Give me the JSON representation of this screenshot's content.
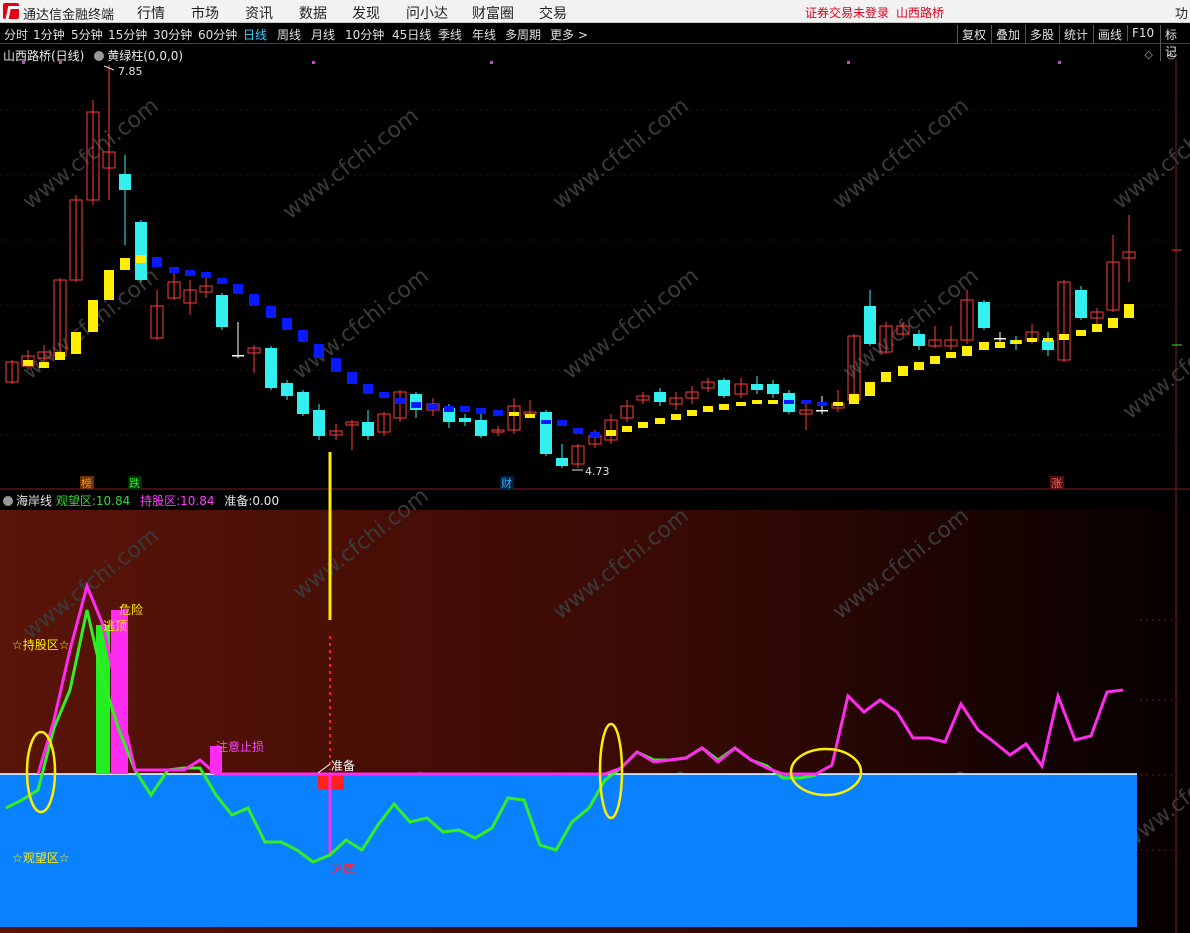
{
  "app": {
    "title": "通达信金融终端",
    "menus": [
      "行情",
      "市场",
      "资讯",
      "数据",
      "发现",
      "问小达",
      "财富圈",
      "交易"
    ],
    "login_notice": "证券交易未登录",
    "account_name": "山西路桥",
    "func_label": "功"
  },
  "periods": {
    "items": [
      "分时",
      "1分钟",
      "5分钟",
      "15分钟",
      "30分钟",
      "60分钟",
      "日线",
      "周线",
      "月线",
      "10分钟",
      "45日线",
      "季线",
      "年线",
      "多周期",
      "更多 >"
    ],
    "active": "日线",
    "right_tools": [
      "复权",
      "叠加",
      "多股",
      "统计",
      "画线",
      "F10",
      "标记"
    ]
  },
  "main_chart": {
    "stock_label": "山西路桥(日线)",
    "indicator_label": "黄绿柱(0,0,0)",
    "high_label": "7.85",
    "low_label": "4.73",
    "markers": [
      {
        "text": "榜",
        "color": "#ff9900"
      },
      {
        "text": "跌",
        "color": "#39e639"
      },
      {
        "text": "财",
        "color": "#36b0ff"
      },
      {
        "text": "涨",
        "color": "#ff6060"
      }
    ]
  },
  "sub_chart": {
    "name": "海岸线",
    "watch_label": "观望区:",
    "watch_value": "10.84",
    "hold_label": "持股区:",
    "hold_value": "10.84",
    "ready_label": "准备:",
    "ready_value": "0.00",
    "annotations": {
      "hold_zone": "☆持股区☆",
      "watch_zone": "☆观望区☆",
      "danger": "危险",
      "escape_top": "逃顶",
      "stop_loss": "注意止损",
      "ready": "准备",
      "escape_bottom": "逃底"
    }
  },
  "watermark": "www.cfchi.com",
  "colors": {
    "up_candle": "#ff3b3b",
    "down_candle": "#33f0f0",
    "yellow_bar": "#ffee00",
    "blue_bar": "#0a1aff",
    "magenta_line": "#ff2bf0",
    "green_line": "#33ee22",
    "watch_zone_fill": "#0a82ff",
    "ellipse": "#ffee00"
  }
}
